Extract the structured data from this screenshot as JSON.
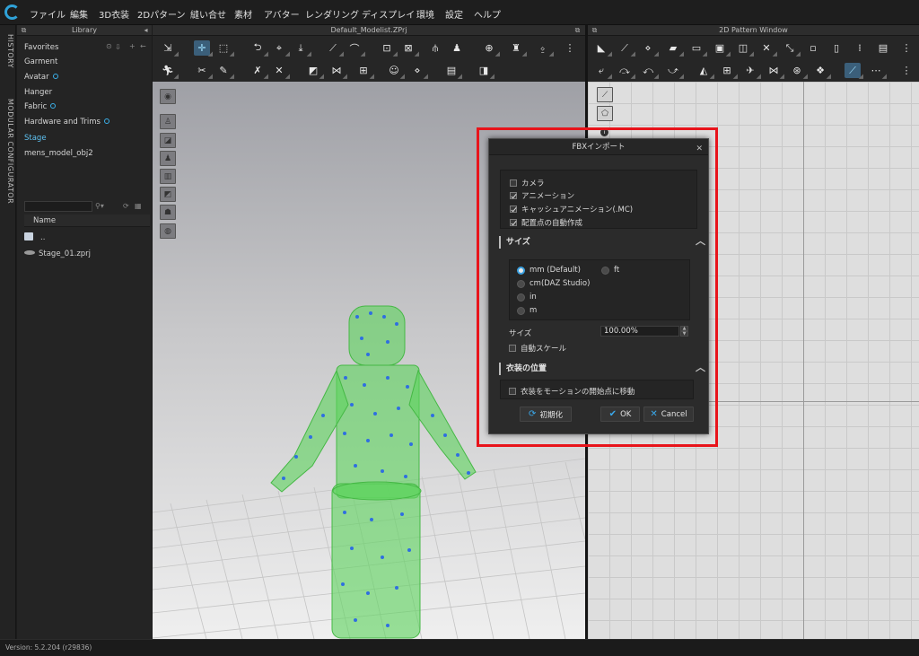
{
  "menu": {
    "items": [
      "ファイル",
      "編集",
      "3D衣装",
      "2Dパターン",
      "縫い合せ",
      "素材",
      "アバター",
      "レンダリング",
      "ディスプレイ",
      "環境",
      "設定",
      "ヘルプ"
    ]
  },
  "side_tabs": {
    "history": "HISTORY",
    "modular": "MODULAR CONFIGURATOR"
  },
  "library": {
    "title": "Library",
    "items": [
      {
        "label": "Favorites",
        "marker": false
      },
      {
        "label": "Garment",
        "marker": false
      },
      {
        "label": "Avatar",
        "marker": true
      },
      {
        "label": "Hanger",
        "marker": false
      },
      {
        "label": "Fabric",
        "marker": true
      },
      {
        "label": "Hardware and Trims",
        "marker": true
      },
      {
        "label": "Stage",
        "marker": false
      },
      {
        "label": "mens_model_obj2",
        "marker": false
      }
    ],
    "active_item": "Stage",
    "search_placeholder": "",
    "column_header": "Name",
    "files": [
      {
        "name": "..",
        "icon": "folder-icon"
      },
      {
        "name": "Stage_01.zprj",
        "icon": "stage-file-icon"
      }
    ]
  },
  "viewport3d": {
    "title": "Default_Modelist.ZPrj"
  },
  "pattern2d": {
    "title": "2D Pattern Window"
  },
  "status": {
    "version": "Version: 5.2.204 (r29836)"
  },
  "dialog": {
    "title": "FBXインポート",
    "options": [
      {
        "label": "カメラ",
        "checked": false
      },
      {
        "label": "アニメーション",
        "checked": true
      },
      {
        "label": "キャッシュアニメーション(.MC)",
        "checked": true
      },
      {
        "label": "配置点の自動作成",
        "checked": true
      }
    ],
    "size_section": {
      "title": "サイズ",
      "units": [
        {
          "label": "mm (Default)",
          "selected": true
        },
        {
          "label": "ft",
          "selected": false
        },
        {
          "label": "cm(DAZ Studio)",
          "selected": false
        },
        {
          "label": "in",
          "selected": false
        },
        {
          "label": "m",
          "selected": false
        }
      ],
      "size_label": "サイズ",
      "size_value": "100.00%",
      "auto_scale_label": "自動スケール",
      "auto_scale_checked": false
    },
    "position_section": {
      "title": "衣装の位置",
      "move_label": "衣装をモーションの開始点に移動",
      "move_checked": false
    },
    "buttons": {
      "reset": "初期化",
      "ok": "OK",
      "cancel": "Cancel"
    }
  },
  "colors": {
    "accent": "#3aa9ec",
    "highlight": "#e8141b",
    "avatar_fill": "#5fd35f"
  }
}
